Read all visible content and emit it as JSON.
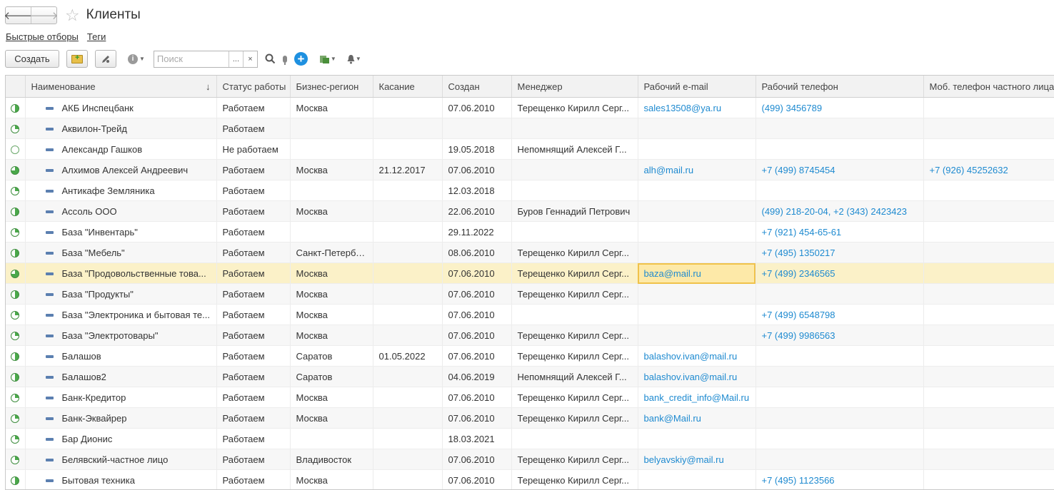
{
  "window": {
    "title": "Клиенты"
  },
  "filters": {
    "quick": "Быстрые отборы",
    "tags": "Теги"
  },
  "toolbar": {
    "create_label": "Создать",
    "search_placeholder": "Поиск",
    "search_more": "...",
    "search_clear": "×"
  },
  "icons": [
    "back-arrow-icon",
    "forward-arrow-icon",
    "star-icon",
    "add-folder-icon",
    "edit-icon",
    "info-icon",
    "search-icon",
    "microphone-icon",
    "plus-icon",
    "report-icon",
    "bell-icon"
  ],
  "accent_color": "#1e8ad0",
  "columns": [
    "Наименование",
    "Статус работы",
    "Бизнес-регион",
    "Касание",
    "Создан",
    "Менеджер",
    "Рабочий e-mail",
    "Рабочий телефон",
    "Моб. телефон частного лица"
  ],
  "sort_indicator": "↓",
  "rows": [
    {
      "status": "half",
      "name": "АКБ Инспецбанк",
      "work": "Работаем",
      "region": "Москва",
      "touch": "",
      "created": "07.06.2010",
      "manager": "Терещенко Кирилл Серг...",
      "email": "sales13508@ya.ru",
      "phone": "(499) 3456789",
      "mobile": ""
    },
    {
      "status": "quarter",
      "name": "Аквилон-Трейд",
      "work": "Работаем",
      "region": "",
      "touch": "",
      "created": "",
      "manager": "",
      "email": "",
      "phone": "",
      "mobile": ""
    },
    {
      "status": "empty",
      "name": "Александр Гашков",
      "work": "Не работаем",
      "region": "",
      "touch": "",
      "created": "19.05.2018",
      "manager": "Непомнящий Алексей Г...",
      "email": "",
      "phone": "",
      "mobile": ""
    },
    {
      "status": "threeq",
      "name": "Алхимов Алексей Андреевич",
      "work": "Работаем",
      "region": "Москва",
      "touch": "21.12.2017",
      "created": "07.06.2010",
      "manager": "",
      "email": "alh@mail.ru",
      "phone": "+7 (499) 8745454",
      "mobile": "+7 (926) 45252632"
    },
    {
      "status": "quarter",
      "name": "Антикафе Земляника",
      "work": "Работаем",
      "region": "",
      "touch": "",
      "created": "12.03.2018",
      "manager": "",
      "email": "",
      "phone": "",
      "mobile": ""
    },
    {
      "status": "half",
      "name": "Ассоль ООО",
      "work": "Работаем",
      "region": "Москва",
      "touch": "",
      "created": "22.06.2010",
      "manager": "Буров Геннадий Петрович",
      "email": "",
      "phone": "(499) 218-20-04, +2 (343) 2423423",
      "mobile": ""
    },
    {
      "status": "quarter",
      "name": "База \"Инвентарь\"",
      "work": "Работаем",
      "region": "",
      "touch": "",
      "created": "29.11.2022",
      "manager": "",
      "email": "",
      "phone": "+7 (921) 454-65-61",
      "mobile": ""
    },
    {
      "status": "half",
      "name": "База \"Мебель\"",
      "work": "Работаем",
      "region": "Санкт-Петербург",
      "touch": "",
      "created": "08.06.2010",
      "manager": "Терещенко Кирилл Серг...",
      "email": "",
      "phone": "+7 (495) 1350217",
      "mobile": ""
    },
    {
      "status": "threeq",
      "name": "База \"Продовольственные това...",
      "work": "Работаем",
      "region": "Москва",
      "touch": "",
      "created": "07.06.2010",
      "manager": "Терещенко Кирилл Серг...",
      "email": "baza@mail.ru",
      "phone": "+7 (499) 2346565",
      "mobile": ""
    },
    {
      "status": "half",
      "name": "База \"Продукты\"",
      "work": "Работаем",
      "region": "Москва",
      "touch": "",
      "created": "07.06.2010",
      "manager": "Терещенко Кирилл Серг...",
      "email": "",
      "phone": "",
      "mobile": ""
    },
    {
      "status": "quarter",
      "name": "База \"Электроника и бытовая те...",
      "work": "Работаем",
      "region": "Москва",
      "touch": "",
      "created": "07.06.2010",
      "manager": "",
      "email": "",
      "phone": "+7 (499) 6548798",
      "mobile": ""
    },
    {
      "status": "quarter",
      "name": "База \"Электротовары\"",
      "work": "Работаем",
      "region": "Москва",
      "touch": "",
      "created": "07.06.2010",
      "manager": "Терещенко Кирилл Серг...",
      "email": "",
      "phone": "+7 (499) 9986563",
      "mobile": ""
    },
    {
      "status": "half",
      "name": "Балашов",
      "work": "Работаем",
      "region": "Саратов",
      "touch": "01.05.2022",
      "created": "07.06.2010",
      "manager": "Терещенко Кирилл Серг...",
      "email": "balashov.ivan@mail.ru",
      "phone": "",
      "mobile": ""
    },
    {
      "status": "half",
      "name": "Балашов2",
      "work": "Работаем",
      "region": "Саратов",
      "touch": "",
      "created": "04.06.2019",
      "manager": "Непомнящий Алексей Г...",
      "email": "balashov.ivan@mail.ru",
      "phone": "",
      "mobile": ""
    },
    {
      "status": "quarter",
      "name": "Банк-Кредитор",
      "work": "Работаем",
      "region": "Москва",
      "touch": "",
      "created": "07.06.2010",
      "manager": "Терещенко Кирилл Серг...",
      "email": "bank_credit_info@Mail.ru",
      "phone": "",
      "mobile": ""
    },
    {
      "status": "quarter",
      "name": "Банк-Эквайрер",
      "work": "Работаем",
      "region": "Москва",
      "touch": "",
      "created": "07.06.2010",
      "manager": "Терещенко Кирилл Серг...",
      "email": "bank@Mail.ru",
      "phone": "",
      "mobile": ""
    },
    {
      "status": "quarter",
      "name": "Бар Дионис",
      "work": "Работаем",
      "region": "",
      "touch": "",
      "created": "18.03.2021",
      "manager": "",
      "email": "",
      "phone": "",
      "mobile": ""
    },
    {
      "status": "quarter",
      "name": "Белявский-частное лицо",
      "work": "Работаем",
      "region": "Владивосток",
      "touch": "",
      "created": "07.06.2010",
      "manager": "Терещенко Кирилл Серг...",
      "email": "belyavskiy@mail.ru",
      "phone": "",
      "mobile": ""
    },
    {
      "status": "half",
      "name": "Бытовая техника",
      "work": "Работаем",
      "region": "Москва",
      "touch": "",
      "created": "07.06.2010",
      "manager": "Терещенко Кирилл Серг...",
      "email": "",
      "phone": "+7 (495) 1123566",
      "mobile": ""
    }
  ],
  "selected_row": 8,
  "current_cell": "email"
}
